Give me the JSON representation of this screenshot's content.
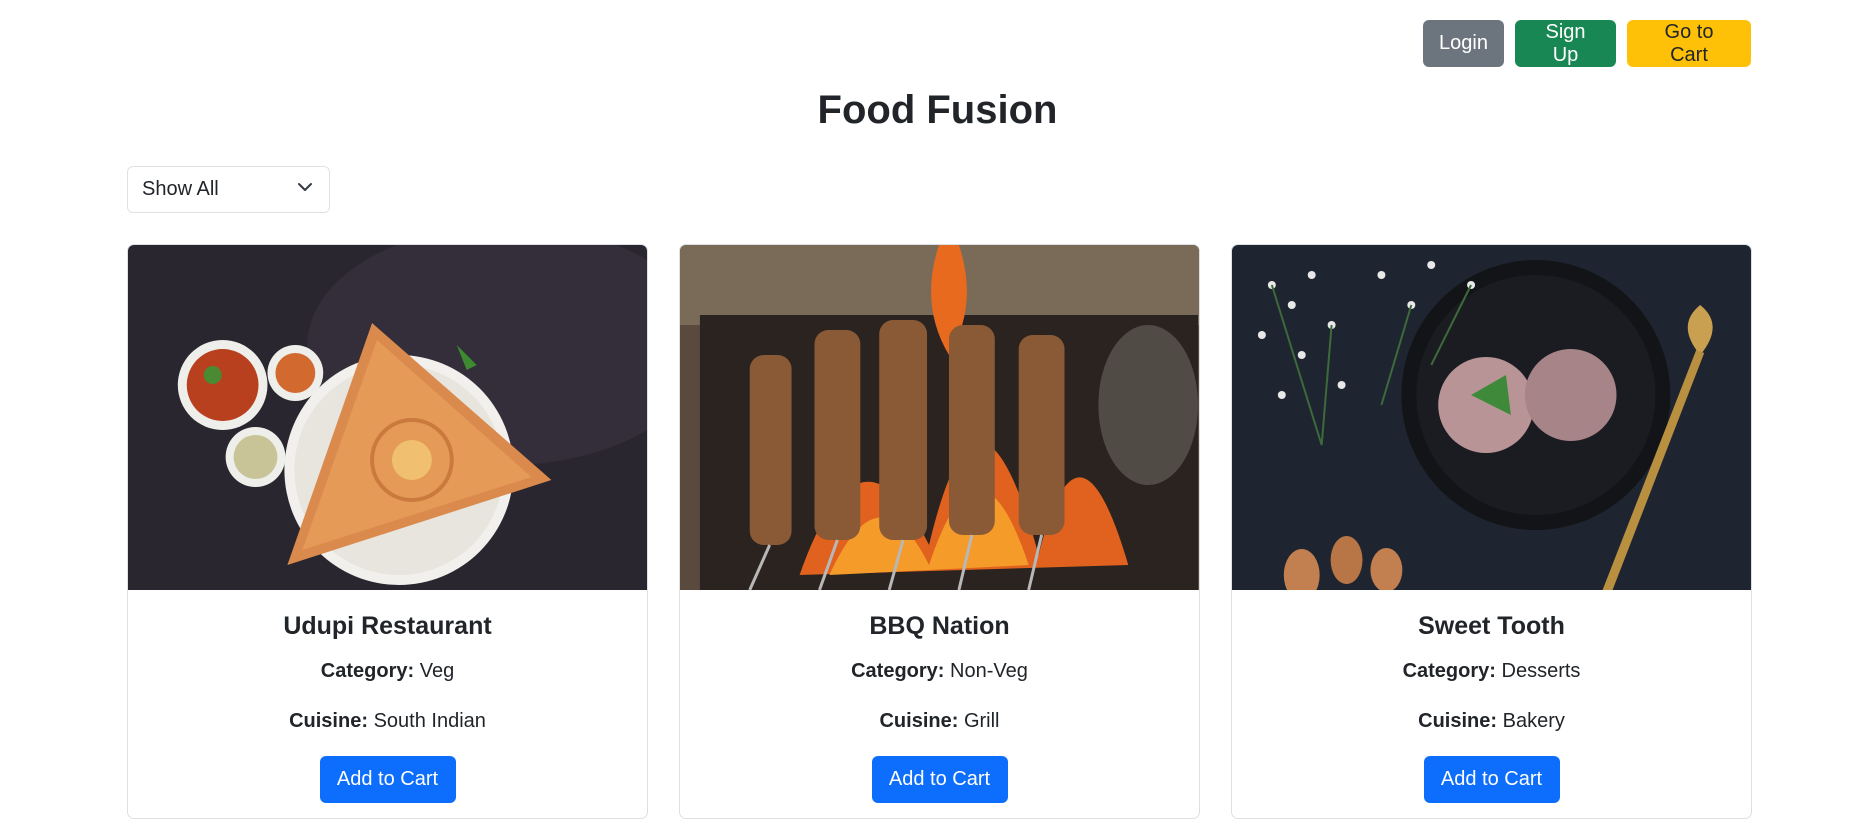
{
  "header": {
    "login_label": "Login",
    "signup_label": "Sign Up",
    "cart_label": "Go to Cart"
  },
  "page": {
    "title": "Food Fusion"
  },
  "filter": {
    "selected": "Show All"
  },
  "labels": {
    "category": "Category:",
    "cuisine": "Cuisine:"
  },
  "restaurants": [
    {
      "name": "Udupi Restaurant",
      "category": "Veg",
      "cuisine": "South Indian",
      "button": "Add to Cart"
    },
    {
      "name": "BBQ Nation",
      "category": "Non-Veg",
      "cuisine": "Grill",
      "button": "Add to Cart"
    },
    {
      "name": "Sweet Tooth",
      "category": "Desserts",
      "cuisine": "Bakery",
      "button": "Add to Cart"
    }
  ],
  "colors": {
    "primary": "#0d6efd",
    "secondary": "#6c757d",
    "success": "#198754",
    "warning": "#ffc107"
  }
}
